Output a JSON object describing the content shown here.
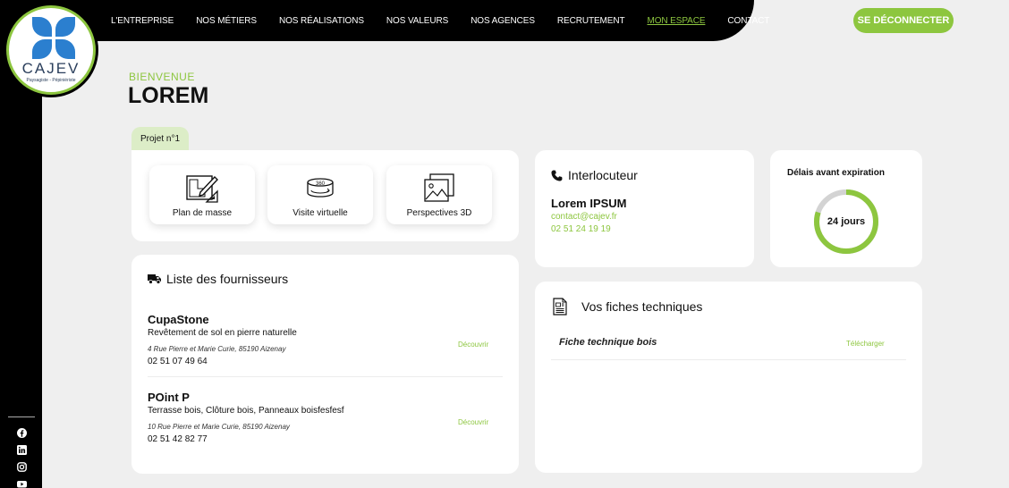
{
  "logo": {
    "name": "CAJEV",
    "tagline": "Paysagiste - Pépiniériste"
  },
  "nav": {
    "items": [
      "L'ENTREPRISE",
      "NOS MÉTIERS",
      "NOS RÉALISATIONS",
      "NOS VALEURS",
      "NOS AGENCES",
      "RECRUTEMENT",
      "MON ESPACE",
      "CONTACT"
    ],
    "active": "MON ESPACE",
    "logout_label": "SE DÉCONNECTER"
  },
  "welcome": {
    "label": "BIENVENUE",
    "name": "LOREM"
  },
  "project": {
    "tab_label": "Projet n°1",
    "documents": [
      {
        "label": "Plan de masse",
        "icon": "blueprint-icon"
      },
      {
        "label": "Visite virtuelle",
        "icon": "360-view-icon"
      },
      {
        "label": "Perspectives 3D",
        "icon": "gallery-icon"
      }
    ]
  },
  "contact": {
    "title": "Interlocuteur",
    "name": "Lorem IPSUM",
    "email": "contact@cajev.fr",
    "phone": "02 51 24 19 19"
  },
  "expiration": {
    "title": "Délais avant expiration",
    "value": "24 jours",
    "progress": 0.8
  },
  "suppliers": {
    "title": "Liste des fournisseurs",
    "items": [
      {
        "name": "CupaStone",
        "desc": "Revêtement de sol en pierre naturelle",
        "address": "4 Rue Pierre et Marie Curie, 85190 Aizenay",
        "phone": "02 51 07 49 64",
        "link": "Découvrir"
      },
      {
        "name": "POint P",
        "desc": "Terrasse bois, Clôture bois, Panneaux boisfesfesf",
        "address": "10 Rue Pierre et Marie Curie, 85190 Aizenay",
        "phone": "02 51 42 82 77",
        "link": "Découvrir"
      }
    ]
  },
  "sheets": {
    "title": "Vos fiches techniques",
    "items": [
      {
        "name": "Fiche technique bois",
        "link": "Télécharger"
      }
    ]
  },
  "social": [
    "facebook-icon",
    "linkedin-icon",
    "instagram-icon",
    "youtube-icon"
  ],
  "colors": {
    "accent": "#8dc63f",
    "brand_blue": "#2b7fcf",
    "dark": "#000000",
    "background": "#efefef"
  }
}
